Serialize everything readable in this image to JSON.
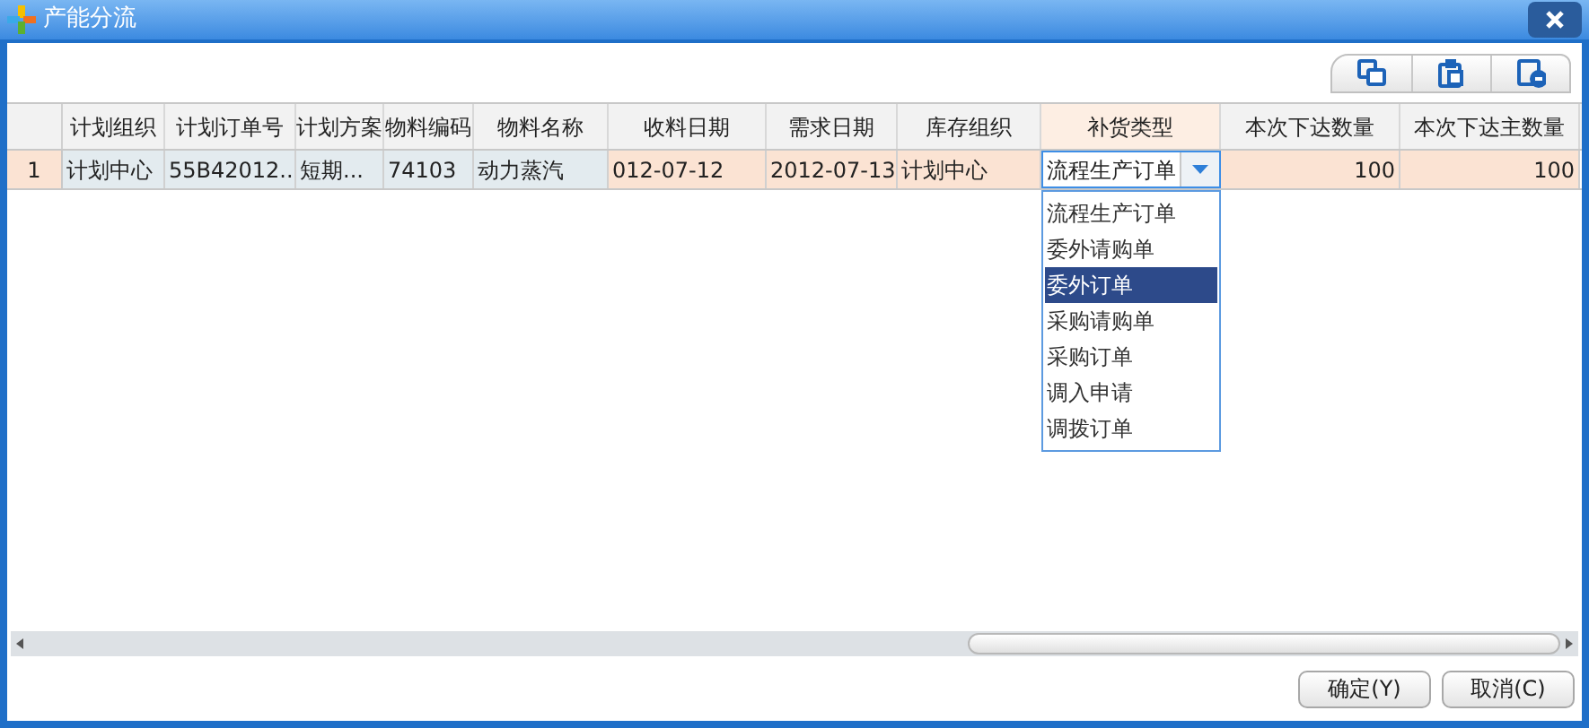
{
  "window": {
    "title": "产能分流"
  },
  "columns": [
    {
      "header": "计划组织",
      "kind": "locked",
      "selected": false
    },
    {
      "header": "计划订单号",
      "kind": "locked",
      "selected": false
    },
    {
      "header": "计划方案",
      "kind": "locked",
      "selected": false
    },
    {
      "header": "物料编码",
      "kind": "locked",
      "selected": false
    },
    {
      "header": "物料名称",
      "kind": "locked",
      "selected": false
    },
    {
      "header": "收料日期",
      "kind": "editable",
      "selected": false
    },
    {
      "header": "需求日期",
      "kind": "editable",
      "selected": false
    },
    {
      "header": "库存组织",
      "kind": "editable",
      "selected": false
    },
    {
      "header": "补货类型",
      "kind": "combo",
      "selected": true
    },
    {
      "header": "本次下达数量",
      "kind": "number",
      "selected": false
    },
    {
      "header": "本次下达主数量",
      "kind": "number",
      "selected": false
    }
  ],
  "rows": [
    {
      "number": "1",
      "cells": [
        "计划中心",
        "55B42012...",
        "短期...",
        "74103",
        "动力蒸汽",
        "012-07-12",
        "2012-07-13",
        "计划中心",
        "流程生产订单",
        "100",
        "100"
      ]
    }
  ],
  "dropdown": {
    "options": [
      {
        "label": "流程生产订单",
        "selected": false
      },
      {
        "label": "委外请购单",
        "selected": false
      },
      {
        "label": "委外订单",
        "selected": true
      },
      {
        "label": "采购请购单",
        "selected": false
      },
      {
        "label": "采购订单",
        "selected": false
      },
      {
        "label": "调入申请",
        "selected": false
      },
      {
        "label": "调拨订单",
        "selected": false
      }
    ]
  },
  "buttons": [
    "确定(Y)",
    "取消(C)"
  ]
}
